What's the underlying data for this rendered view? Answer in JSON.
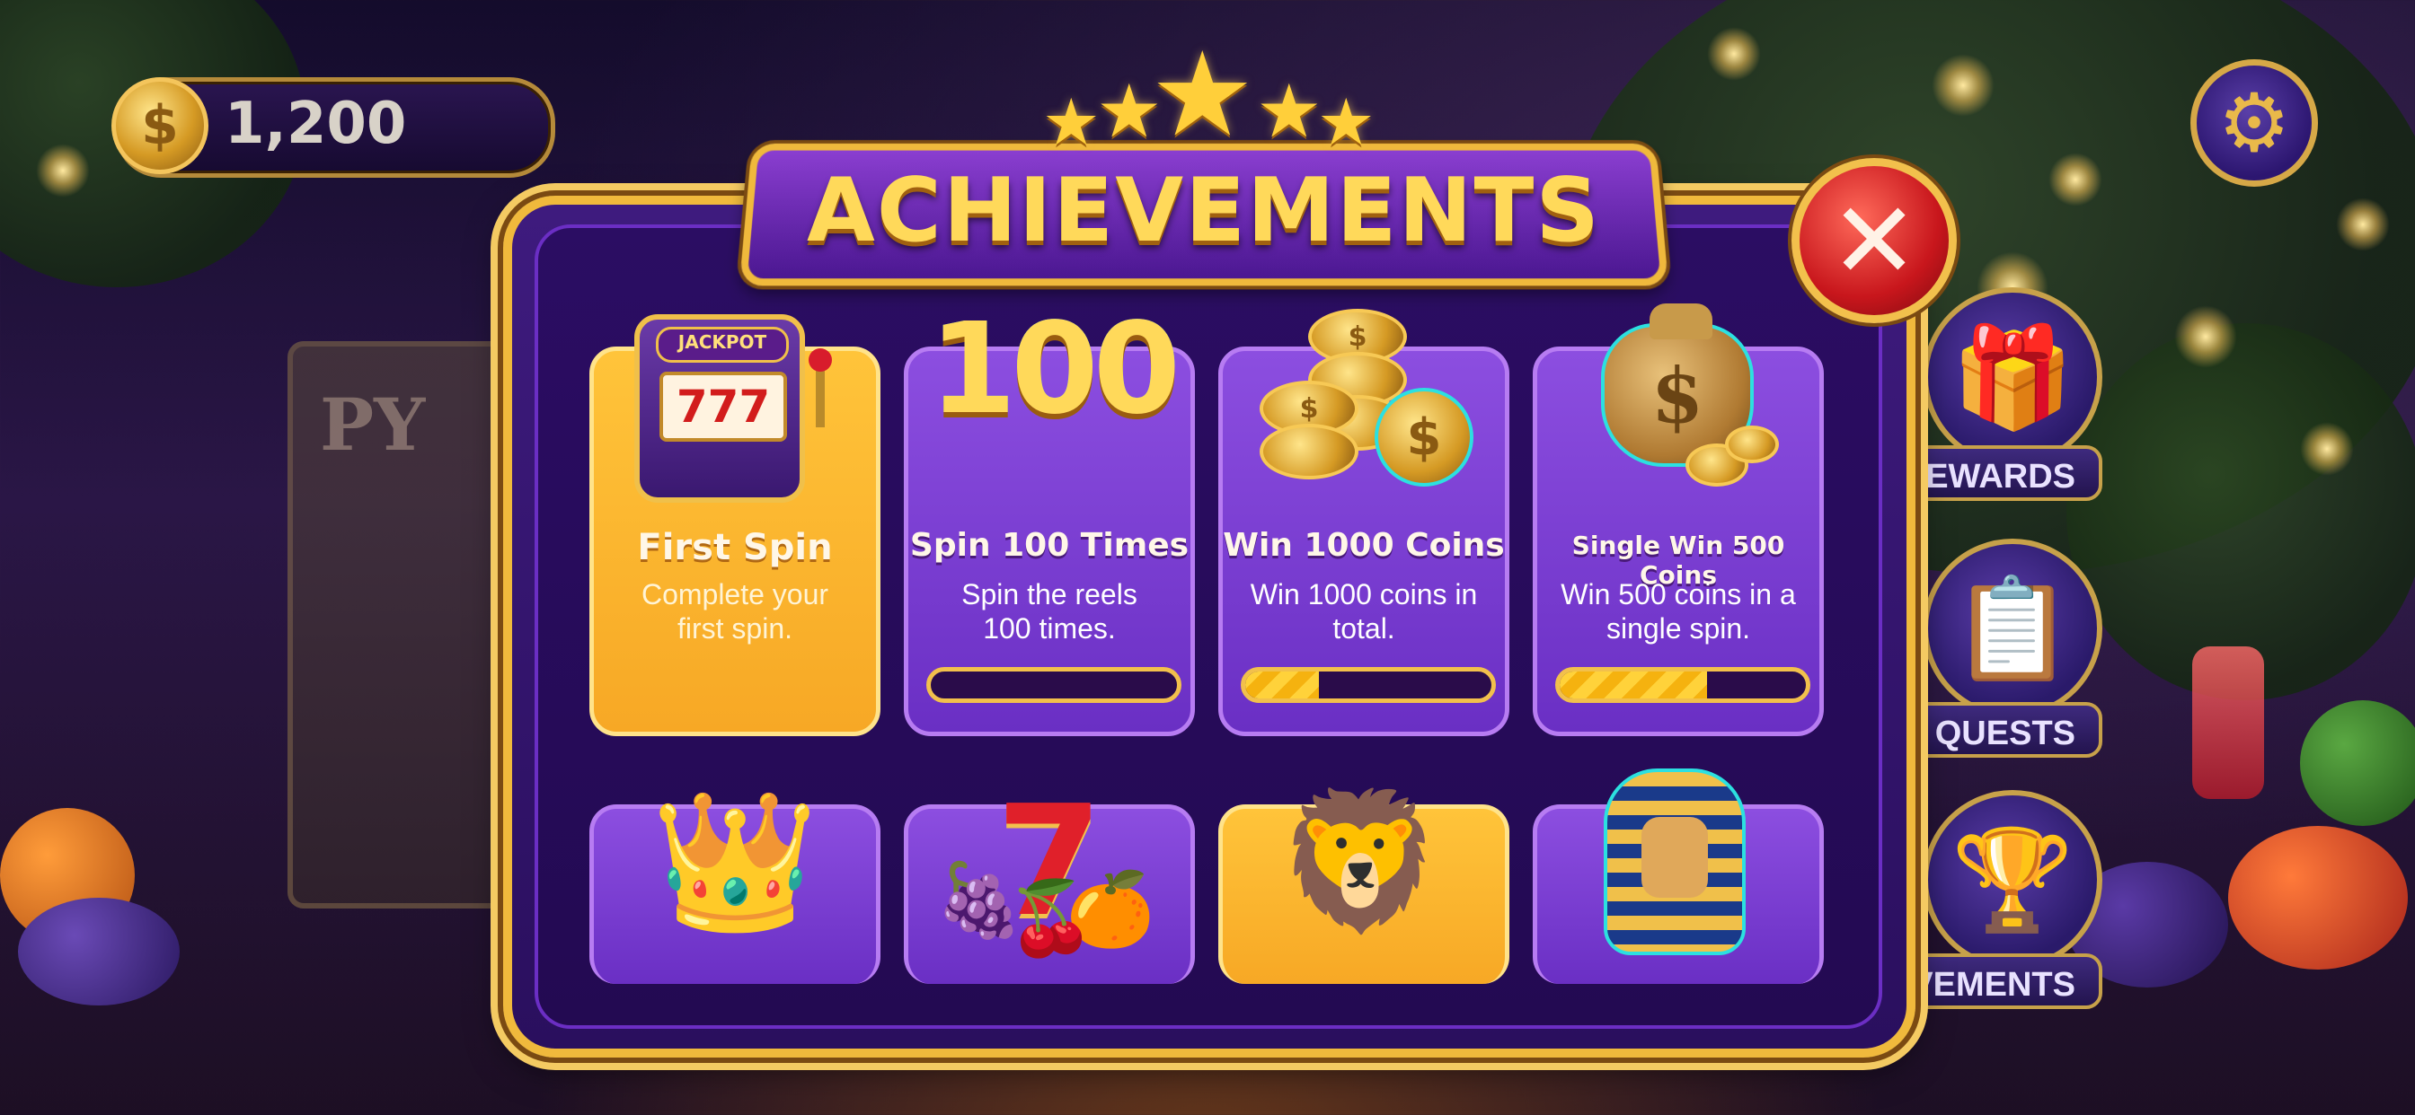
{
  "header": {
    "coin_balance": "1,200",
    "coin_symbol": "$"
  },
  "modal": {
    "title": "ACHIEVEMENTS",
    "close_symbol": "✕"
  },
  "achievements": [
    {
      "title": "First Spin",
      "description": "Complete your first spin.",
      "icon": "slot-machine-icon",
      "icon_text_jackpot": "JACKPOT",
      "reels": "777",
      "completed": true
    },
    {
      "title": "Spin 100 Times",
      "description": "Spin the reels 100 times.",
      "icon": "number-100-icon",
      "icon_text": "100",
      "progress": 0.0
    },
    {
      "title": "Win 1000 Coins",
      "description": "Win 1000 coins in total.",
      "icon": "coin-stack-icon",
      "progress": 0.3
    },
    {
      "title": "Single Win 500 Coins",
      "description": "Win 500 coins in a single spin.",
      "icon": "money-bag-icon",
      "progress": 0.6
    },
    {
      "icon": "crown-icon",
      "completed": false
    },
    {
      "icon": "lucky-fruits-icon",
      "icon_text": "7",
      "completed": false
    },
    {
      "icon": "lion-icon",
      "completed": true
    },
    {
      "icon": "pharaoh-icon",
      "completed": false
    }
  ],
  "side_menu": [
    {
      "label": "EWARDS",
      "icon": "gift-icon"
    },
    {
      "label": "QUESTS",
      "icon": "clipboard-icon"
    },
    {
      "label": "IEVEMENTS",
      "icon": "trophy-icon"
    }
  ],
  "background_machine_text": "PY",
  "colors": {
    "gold": "#f0b93c",
    "purple": "#6a2fc4",
    "card_gold": "#ffc43a",
    "close_red": "#c8161c"
  }
}
